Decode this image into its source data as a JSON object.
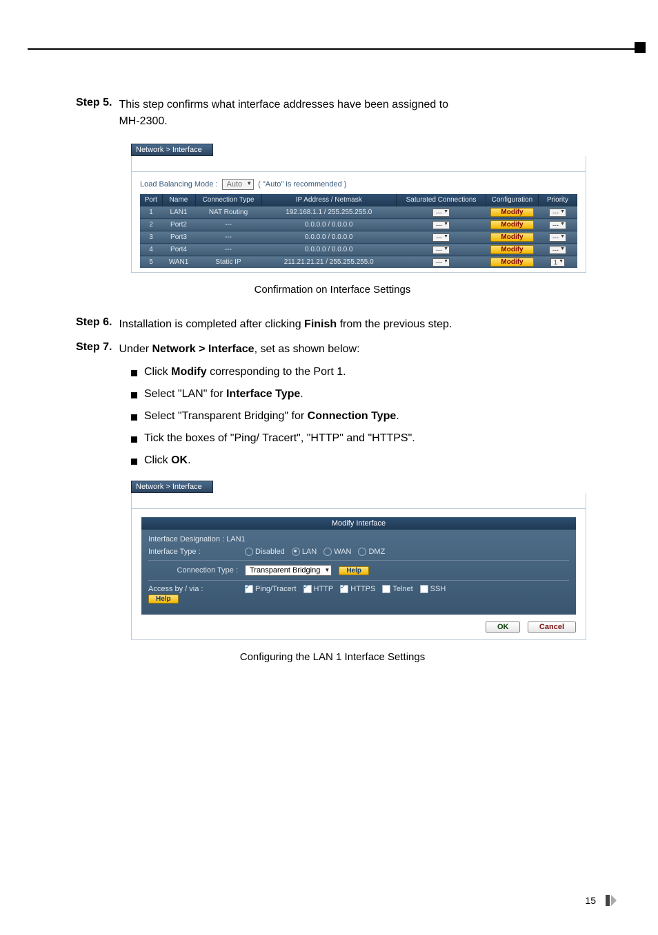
{
  "topbar": {},
  "step5": {
    "label": "Step 5.",
    "body_a": "This step confirms what interface addresses have been assigned to ",
    "body_b": "MH-2300."
  },
  "ss1": {
    "breadcrumb": "Network > Interface",
    "lb_label": "Load Balancing Mode :",
    "lb_value": "Auto",
    "lb_note": "( \"Auto\" is recommended )",
    "headers": {
      "port": "Port",
      "name": "Name",
      "ctype": "Connection Type",
      "ip": "IP Address / Netmask",
      "sat": "Saturated Connections",
      "conf": "Configuration",
      "prio": "Priority"
    },
    "rows": [
      {
        "port": "1",
        "name": "LAN1",
        "ctype": "NAT Routing",
        "ip": "192.168.1.1 / 255.255.255.0",
        "sat": "---",
        "conf": "Modify",
        "prio": "---"
      },
      {
        "port": "2",
        "name": "Port2",
        "ctype": "---",
        "ip": "0.0.0.0 / 0.0.0.0",
        "sat": "---",
        "conf": "Modify",
        "prio": "---"
      },
      {
        "port": "3",
        "name": "Port3",
        "ctype": "---",
        "ip": "0.0.0.0 / 0.0.0.0",
        "sat": "---",
        "conf": "Modify",
        "prio": "---"
      },
      {
        "port": "4",
        "name": "Port4",
        "ctype": "---",
        "ip": "0.0.0.0 / 0.0.0.0",
        "sat": "---",
        "conf": "Modify",
        "prio": "---"
      },
      {
        "port": "5",
        "name": "WAN1",
        "ctype": "Static IP",
        "ip": "211.21.21.21 / 255.255.255.0",
        "sat": "---",
        "conf": "Modify",
        "prio": "1"
      }
    ],
    "caption": "Confirmation on Interface Settings"
  },
  "step6": {
    "label": "Step 6.",
    "a": "Installation is completed after clicking ",
    "b": "Finish",
    "c": " from the previous step."
  },
  "step7": {
    "label": "Step 7.",
    "a": "Under ",
    "b": "Network > Interface",
    "c": ", set as shown below:",
    "bullets": [
      {
        "pre": "Click ",
        "bold": "Modify",
        "post": " corresponding to the Port 1."
      },
      {
        "pre": "Select \"LAN\" for ",
        "bold": "Interface Type",
        "post": "."
      },
      {
        "pre": "Select \"Transparent Bridging\" for ",
        "bold": "Connection Type",
        "post": "."
      },
      {
        "pre": "Tick the boxes of \"Ping/ Tracert\", \"HTTP\" and \"HTTPS\".",
        "bold": "",
        "post": ""
      },
      {
        "pre": "Click ",
        "bold": "OK",
        "post": "."
      }
    ]
  },
  "ss2": {
    "breadcrumb": "Network > Interface",
    "title": "Modify Interface",
    "designation_label": "Interface Designation : LAN1",
    "iftype_label": "Interface Type :",
    "iftype_opts": [
      "Disabled",
      "LAN",
      "WAN",
      "DMZ"
    ],
    "conntype_label": "Connection Type :",
    "conntype_value": "Transparent Bridging",
    "help": "Help",
    "access_label": "Access by / via :",
    "access_opts": [
      "Ping/Tracert",
      "HTTP",
      "HTTPS",
      "Telnet",
      "SSH"
    ],
    "ok": "OK",
    "cancel": "Cancel",
    "caption": "Configuring the LAN 1 Interface Settings"
  },
  "page_number": "15"
}
